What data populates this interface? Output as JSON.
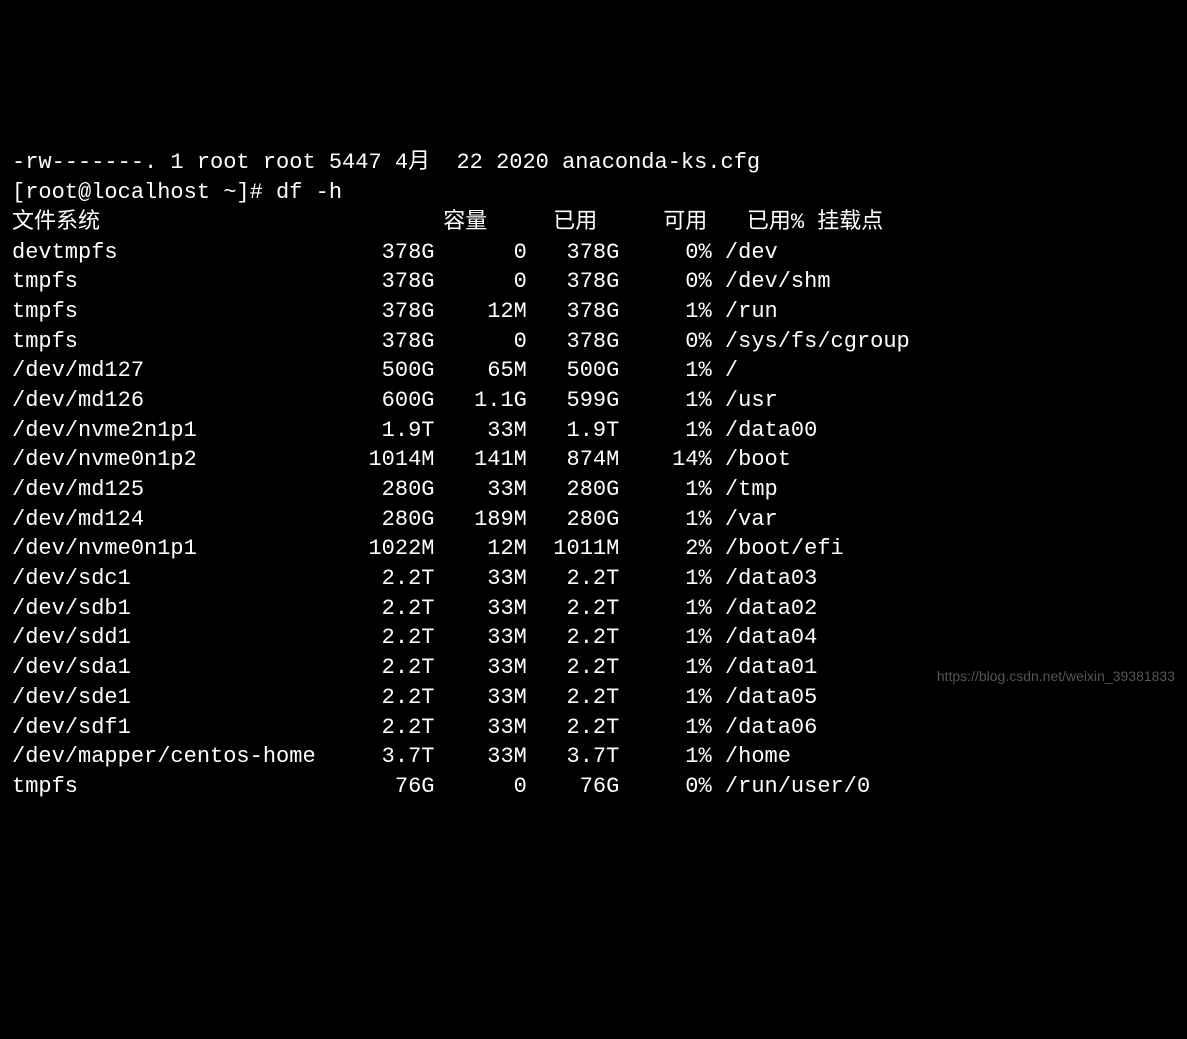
{
  "top_line_fragment": "-rw-------. 1 root root 5447 4月  22 2020 anaconda-ks.cfg",
  "prompt": "[root@localhost ~]# ",
  "command": "df -h",
  "headers": {
    "filesystem": "文件系统",
    "size": "容量",
    "used": "已用",
    "avail": "可用",
    "usepct": "已用%",
    "mount": "挂载点"
  },
  "rows": [
    {
      "fs": "devtmpfs",
      "size": "378G",
      "used": "0",
      "avail": "378G",
      "usepct": "0%",
      "mount": "/dev"
    },
    {
      "fs": "tmpfs",
      "size": "378G",
      "used": "0",
      "avail": "378G",
      "usepct": "0%",
      "mount": "/dev/shm"
    },
    {
      "fs": "tmpfs",
      "size": "378G",
      "used": "12M",
      "avail": "378G",
      "usepct": "1%",
      "mount": "/run"
    },
    {
      "fs": "tmpfs",
      "size": "378G",
      "used": "0",
      "avail": "378G",
      "usepct": "0%",
      "mount": "/sys/fs/cgroup"
    },
    {
      "fs": "/dev/md127",
      "size": "500G",
      "used": "65M",
      "avail": "500G",
      "usepct": "1%",
      "mount": "/"
    },
    {
      "fs": "/dev/md126",
      "size": "600G",
      "used": "1.1G",
      "avail": "599G",
      "usepct": "1%",
      "mount": "/usr"
    },
    {
      "fs": "/dev/nvme2n1p1",
      "size": "1.9T",
      "used": "33M",
      "avail": "1.9T",
      "usepct": "1%",
      "mount": "/data00"
    },
    {
      "fs": "/dev/nvme0n1p2",
      "size": "1014M",
      "used": "141M",
      "avail": "874M",
      "usepct": "14%",
      "mount": "/boot"
    },
    {
      "fs": "/dev/md125",
      "size": "280G",
      "used": "33M",
      "avail": "280G",
      "usepct": "1%",
      "mount": "/tmp"
    },
    {
      "fs": "/dev/md124",
      "size": "280G",
      "used": "189M",
      "avail": "280G",
      "usepct": "1%",
      "mount": "/var"
    },
    {
      "fs": "/dev/nvme0n1p1",
      "size": "1022M",
      "used": "12M",
      "avail": "1011M",
      "usepct": "2%",
      "mount": "/boot/efi"
    },
    {
      "fs": "/dev/sdc1",
      "size": "2.2T",
      "used": "33M",
      "avail": "2.2T",
      "usepct": "1%",
      "mount": "/data03"
    },
    {
      "fs": "/dev/sdb1",
      "size": "2.2T",
      "used": "33M",
      "avail": "2.2T",
      "usepct": "1%",
      "mount": "/data02"
    },
    {
      "fs": "/dev/sdd1",
      "size": "2.2T",
      "used": "33M",
      "avail": "2.2T",
      "usepct": "1%",
      "mount": "/data04"
    },
    {
      "fs": "/dev/sda1",
      "size": "2.2T",
      "used": "33M",
      "avail": "2.2T",
      "usepct": "1%",
      "mount": "/data01"
    },
    {
      "fs": "/dev/sde1",
      "size": "2.2T",
      "used": "33M",
      "avail": "2.2T",
      "usepct": "1%",
      "mount": "/data05"
    },
    {
      "fs": "/dev/sdf1",
      "size": "2.2T",
      "used": "33M",
      "avail": "2.2T",
      "usepct": "1%",
      "mount": "/data06"
    },
    {
      "fs": "/dev/mapper/centos-home",
      "size": "3.7T",
      "used": "33M",
      "avail": "3.7T",
      "usepct": "1%",
      "mount": "/home"
    },
    {
      "fs": "tmpfs",
      "size": "76G",
      "used": "0",
      "avail": "76G",
      "usepct": "0%",
      "mount": "/run/user/0"
    }
  ],
  "watermark": "https://blog.csdn.net/weixin_39381833"
}
